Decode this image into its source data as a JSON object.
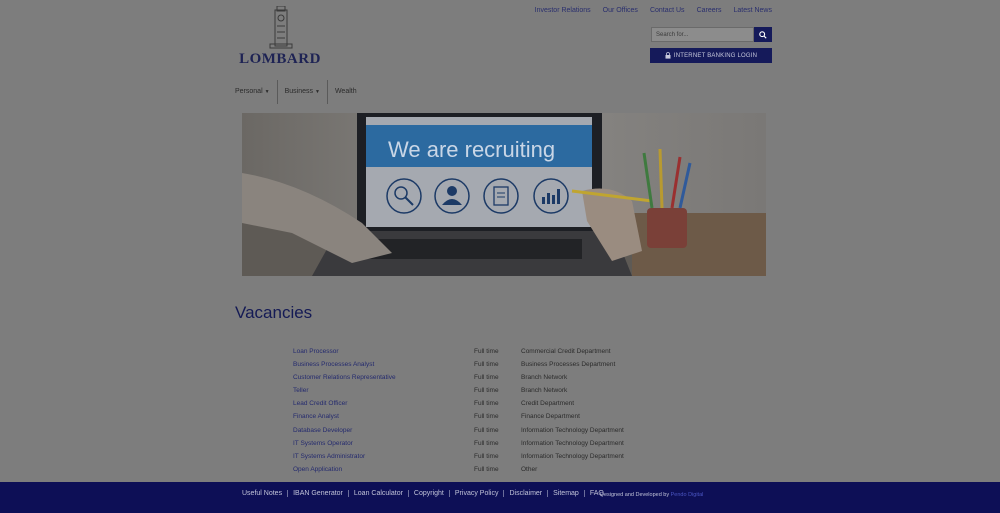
{
  "brand": {
    "name": "LOMBARD",
    "logo_icon": "tower-logo-icon"
  },
  "top_nav": [
    "Investor Relations",
    "Our Offices",
    "Contact Us",
    "Careers",
    "Latest News"
  ],
  "search": {
    "placeholder": "Search for...",
    "icon": "search-icon"
  },
  "internet_banking": {
    "label": "INTERNET BANKING LOGIN",
    "icon": "lock-icon"
  },
  "main_nav": [
    {
      "label": "Personal",
      "has_dropdown": true
    },
    {
      "label": "Business",
      "has_dropdown": true
    },
    {
      "label": "Wealth",
      "has_dropdown": false
    }
  ],
  "banner": {
    "headline": "We are recruiting",
    "icons": [
      "magnifier-icon",
      "person-icon",
      "document-icon",
      "bar-chart-icon"
    ]
  },
  "vacancies": {
    "title": "Vacancies",
    "items": [
      {
        "title": "Loan Processor",
        "type": "Full time",
        "department": "Commercial Credit Department"
      },
      {
        "title": "Business Processes Analyst",
        "type": "Full time",
        "department": "Business Processes Department"
      },
      {
        "title": "Customer Relations Representative",
        "type": "Full time",
        "department": "Branch Network"
      },
      {
        "title": "Teller",
        "type": "Full time",
        "department": "Branch Network"
      },
      {
        "title": "Lead Credit Officer",
        "type": "Full time",
        "department": "Credit Department"
      },
      {
        "title": "Finance Analyst",
        "type": "Full time",
        "department": "Finance Department"
      },
      {
        "title": "Database Developer",
        "type": "Full time",
        "department": "Information Technology Department"
      },
      {
        "title": "IT Systems Operator",
        "type": "Full time",
        "department": "Information Technology Department"
      },
      {
        "title": "IT Systems Administrator",
        "type": "Full time",
        "department": "Information Technology Department"
      },
      {
        "title": "Open Application",
        "type": "Full time",
        "department": "Other"
      }
    ]
  },
  "footer": {
    "links": [
      "Useful Notes",
      "IBAN Generator",
      "Loan Calculator",
      "Copyright",
      "Privacy Policy",
      "Disclaimer",
      "Sitemap",
      "FAQ"
    ],
    "credit_prefix": "Designed and Developed by",
    "credit_name": "Pendo Digital"
  },
  "colors": {
    "navy": "#151a5a",
    "footer_bg": "#0d0f56",
    "overlay_gray": "#7d7d7d",
    "link_blue": "#242a6e"
  }
}
